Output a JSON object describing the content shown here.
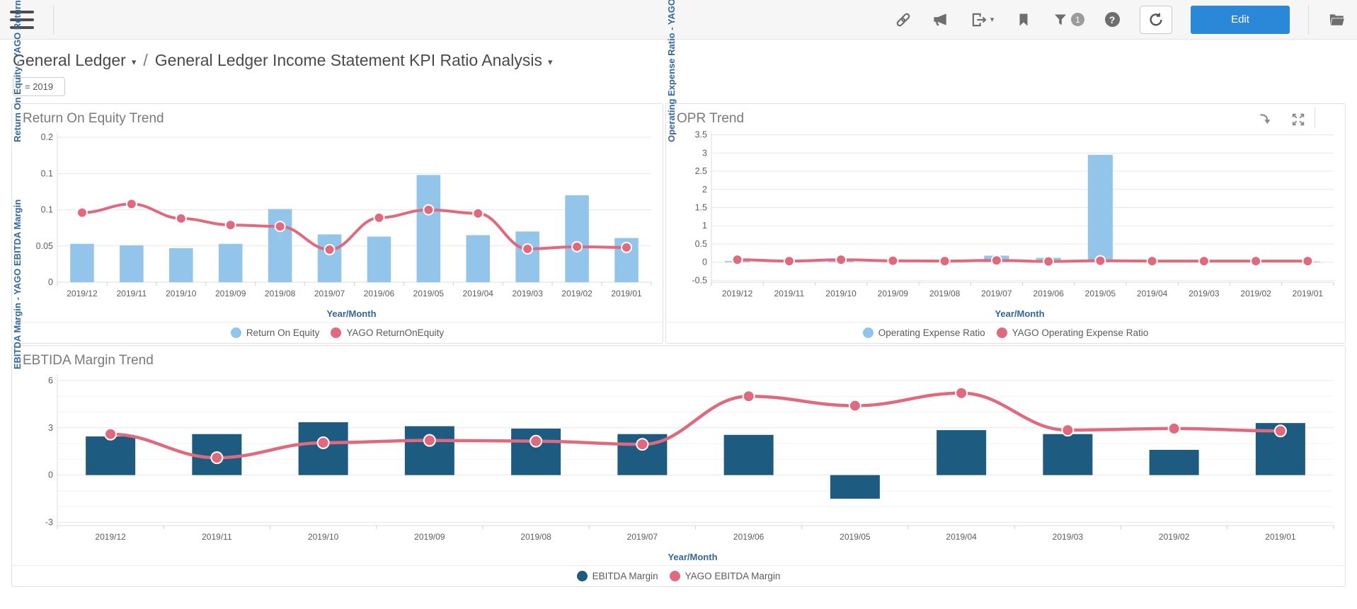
{
  "toolbar": {
    "edit_label": "Edit",
    "filter_badge": "1",
    "help_glyph": "?",
    "caret_glyph": "▾"
  },
  "breadcrumb": {
    "group": "General Ledger",
    "separator": "/",
    "dashboard": "General Ledger Income Statement KPI Ratio Analysis"
  },
  "filter_chip": {
    "label": "= 2019"
  },
  "colors": {
    "bar_light_blue": "#92c5e9",
    "bar_dark_blue": "#1e5b80",
    "line_pink": "#e0697e",
    "accent_blue": "#2b87d8",
    "axis_label_blue": "#34679a"
  },
  "chart_data": [
    {
      "id": "roe",
      "type": "bar+line",
      "title": "Return On Equity Trend",
      "y_axis_label": "Return On Equity - YAGO ReturnOnEquity",
      "x_axis_label": "Year/Month",
      "categories": [
        "2019/12",
        "2019/11",
        "2019/10",
        "2019/09",
        "2019/08",
        "2019/07",
        "2019/06",
        "2019/05",
        "2019/04",
        "2019/03",
        "2019/02",
        "2019/01"
      ],
      "y_ticks": [
        {
          "value": 0.2,
          "label": "0.2"
        },
        {
          "value": 0.15,
          "label": "0.1"
        },
        {
          "value": 0.1,
          "label": "0.1"
        },
        {
          "value": 0.05,
          "label": "0.05"
        },
        {
          "value": 0,
          "label": "0"
        }
      ],
      "y_min": 0,
      "y_max": 0.207,
      "grid": true,
      "legend_position": "bottom",
      "series": [
        {
          "name": "Return On Equity",
          "type": "bar",
          "color": "#92c5e9",
          "values": [
            0.053,
            0.051,
            0.047,
            0.053,
            0.101,
            0.066,
            0.063,
            0.148,
            0.065,
            0.07,
            0.12,
            0.061
          ]
        },
        {
          "name": "YAGO ReturnOnEquity",
          "type": "line",
          "color": "#e0697e",
          "values": [
            0.096,
            0.108,
            0.088,
            0.079,
            0.077,
            0.045,
            0.089,
            0.1,
            0.095,
            0.046,
            0.049,
            0.048
          ]
        }
      ]
    },
    {
      "id": "opr",
      "type": "bar+line",
      "title": "OPR Trend",
      "y_axis_label": "Operating Expense Ratio - YAGO Operating Expense Ratio",
      "x_axis_label": "Year/Month",
      "categories": [
        "2019/12",
        "2019/11",
        "2019/10",
        "2019/09",
        "2019/08",
        "2019/07",
        "2019/06",
        "2019/05",
        "2019/04",
        "2019/03",
        "2019/02",
        "2019/01"
      ],
      "y_ticks": [
        {
          "value": 3.5,
          "label": "3.5"
        },
        {
          "value": 3,
          "label": "3"
        },
        {
          "value": 2.5,
          "label": "2.5"
        },
        {
          "value": 2,
          "label": "2"
        },
        {
          "value": 1.5,
          "label": "1.5"
        },
        {
          "value": 1,
          "label": "1"
        },
        {
          "value": 0.5,
          "label": "0.5"
        },
        {
          "value": 0,
          "label": "0"
        },
        {
          "value": -0.5,
          "label": "-0.5"
        }
      ],
      "y_min": -0.55,
      "y_max": 3.57,
      "grid": true,
      "legend_position": "bottom",
      "header_icons": [
        "drill-down",
        "expand"
      ],
      "series": [
        {
          "name": "Operating Expense Ratio",
          "type": "bar",
          "color": "#92c5e9",
          "values": [
            0.03,
            0.02,
            0.03,
            0.02,
            0.02,
            0.18,
            0.12,
            2.95,
            0.02,
            0.02,
            0.02,
            0.02
          ]
        },
        {
          "name": "YAGO Operating Expense Ratio",
          "type": "line",
          "color": "#e0697e",
          "values": [
            0.07,
            0.03,
            0.07,
            0.04,
            0.03,
            0.05,
            0.02,
            0.04,
            0.03,
            0.03,
            0.03,
            0.03
          ]
        }
      ]
    },
    {
      "id": "ebitda",
      "type": "bar+line",
      "title": "EBTIDA Margin Trend",
      "y_axis_label": "EBITDA Margin - YAGO EBITDA Margin",
      "x_axis_label": "Year/Month",
      "categories": [
        "2019/12",
        "2019/11",
        "2019/10",
        "2019/09",
        "2019/08",
        "2019/07",
        "2019/06",
        "2019/05",
        "2019/04",
        "2019/03",
        "2019/02",
        "2019/01"
      ],
      "y_ticks": [
        {
          "value": 6,
          "label": "6"
        },
        {
          "value": 3,
          "label": "3"
        },
        {
          "value": 0,
          "label": "0"
        },
        {
          "value": -3,
          "label": "-3"
        }
      ],
      "y_minor": [
        5,
        4,
        2,
        1,
        -1,
        -2
      ],
      "y_min": -3.2,
      "y_max": 6.4,
      "grid": true,
      "legend_position": "bottom",
      "series": [
        {
          "name": "EBITDA Margin",
          "type": "bar",
          "color": "#1e5b80",
          "values": [
            2.45,
            2.6,
            3.35,
            3.1,
            2.95,
            2.6,
            2.55,
            -1.5,
            2.85,
            2.6,
            1.6,
            3.3
          ]
        },
        {
          "name": "YAGO EBITDA Margin",
          "type": "line",
          "color": "#e0697e",
          "values": [
            2.6,
            1.1,
            2.05,
            2.2,
            2.15,
            1.95,
            5.0,
            4.4,
            5.2,
            2.85,
            2.95,
            2.8
          ]
        }
      ]
    }
  ]
}
